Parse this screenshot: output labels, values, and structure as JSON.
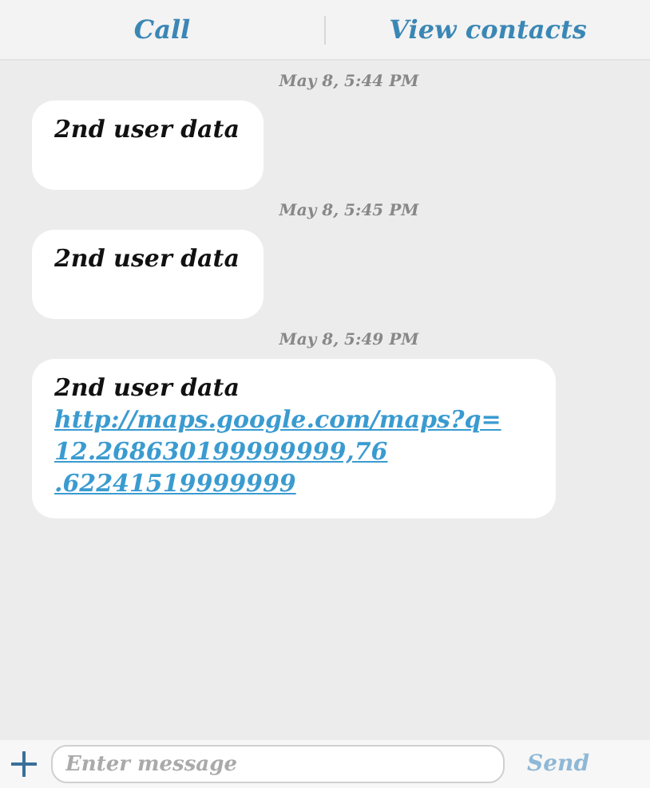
{
  "header": {
    "actions": [
      "Call",
      "View contacts"
    ]
  },
  "messages": [
    {
      "timestamp": "May 8, 5:44 PM",
      "text": "2nd user data"
    },
    {
      "timestamp": "May 8, 5:45 PM",
      "text": "2nd user data"
    },
    {
      "timestamp": "May 8, 5:49 PM",
      "text": "2nd user data",
      "link_lines": [
        "http://maps.google.com/maps?q=",
        "12.268630199999999,76",
        ".62241519999999"
      ]
    }
  ],
  "composer": {
    "placeholder": "Enter message",
    "send": "Send"
  }
}
